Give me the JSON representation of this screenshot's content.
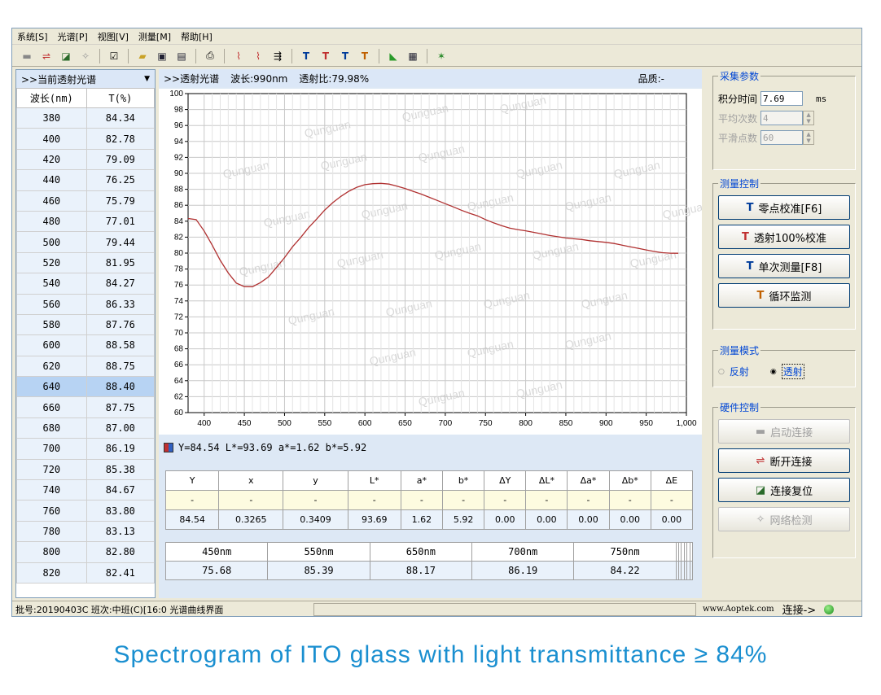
{
  "menu": [
    "系统[S]",
    "光谱[P]",
    "视图[V]",
    "测量[M]",
    "帮助[H]"
  ],
  "left_panel": {
    "header": ">>当前透射光谱",
    "col_wl": "波长(nm)",
    "col_t": "T(%)",
    "rows": [
      [
        "380",
        "84.34"
      ],
      [
        "400",
        "82.78"
      ],
      [
        "420",
        "79.09"
      ],
      [
        "440",
        "76.25"
      ],
      [
        "460",
        "75.79"
      ],
      [
        "480",
        "77.01"
      ],
      [
        "500",
        "79.44"
      ],
      [
        "520",
        "81.95"
      ],
      [
        "540",
        "84.27"
      ],
      [
        "560",
        "86.33"
      ],
      [
        "580",
        "87.76"
      ],
      [
        "600",
        "88.58"
      ],
      [
        "620",
        "88.75"
      ],
      [
        "640",
        "88.40"
      ],
      [
        "660",
        "87.75"
      ],
      [
        "680",
        "87.00"
      ],
      [
        "700",
        "86.19"
      ],
      [
        "720",
        "85.38"
      ],
      [
        "740",
        "84.67"
      ],
      [
        "760",
        "83.80"
      ],
      [
        "780",
        "83.13"
      ],
      [
        "800",
        "82.80"
      ],
      [
        "820",
        "82.41"
      ]
    ],
    "selected_index": 13
  },
  "chart_header": {
    "title": ">>透射光谱",
    "wavelength": "波长:990nm",
    "ratio": "透射比:79.98%",
    "quality": "品质:-"
  },
  "watermark": "Qunguan",
  "chart_data": {
    "type": "line",
    "x": [
      380,
      390,
      400,
      410,
      420,
      430,
      440,
      450,
      460,
      470,
      480,
      490,
      500,
      510,
      520,
      530,
      540,
      550,
      560,
      570,
      580,
      590,
      600,
      610,
      620,
      630,
      640,
      650,
      660,
      670,
      680,
      690,
      700,
      710,
      720,
      730,
      740,
      750,
      760,
      770,
      780,
      790,
      800,
      810,
      820,
      830,
      840,
      850,
      860,
      870,
      880,
      890,
      900,
      910,
      920,
      930,
      940,
      950,
      960,
      970,
      980,
      990
    ],
    "y": [
      84.34,
      84.2,
      82.78,
      81.0,
      79.09,
      77.5,
      76.25,
      75.8,
      75.79,
      76.3,
      77.01,
      78.2,
      79.44,
      80.8,
      81.95,
      83.2,
      84.27,
      85.4,
      86.33,
      87.1,
      87.76,
      88.25,
      88.58,
      88.7,
      88.75,
      88.65,
      88.4,
      88.1,
      87.75,
      87.4,
      87.0,
      86.6,
      86.19,
      85.8,
      85.38,
      85.0,
      84.67,
      84.2,
      83.8,
      83.45,
      83.13,
      82.95,
      82.8,
      82.6,
      82.41,
      82.2,
      82.05,
      81.9,
      81.8,
      81.7,
      81.55,
      81.45,
      81.35,
      81.2,
      81.0,
      80.8,
      80.6,
      80.4,
      80.2,
      80.05,
      79.99,
      79.98
    ],
    "xlim": [
      380,
      1000
    ],
    "ylim": [
      60,
      100
    ],
    "x_ticks": [
      400,
      450,
      500,
      550,
      600,
      650,
      700,
      750,
      800,
      850,
      900,
      950,
      1000
    ],
    "x_tick_labels": [
      "400",
      "450",
      "500",
      "550",
      "600",
      "650",
      "700",
      "750",
      "800",
      "850",
      "900",
      "950",
      "1,000"
    ],
    "y_ticks": [
      60,
      62,
      64,
      66,
      68,
      70,
      72,
      74,
      76,
      78,
      80,
      82,
      84,
      86,
      88,
      90,
      92,
      94,
      96,
      98,
      100
    ],
    "grid": true,
    "line_color": "#b03030"
  },
  "readout": "Y=84.54 L*=93.69 a*=1.62 b*=5.92",
  "color_table": {
    "headers": [
      "Y",
      "x",
      "y",
      "L*",
      "a*",
      "b*",
      "ΔY",
      "ΔL*",
      "Δa*",
      "Δb*",
      "ΔE"
    ],
    "ref": [
      "-",
      "-",
      "-",
      "-",
      "-",
      "-",
      "-",
      "-",
      "-",
      "-",
      "-"
    ],
    "values": [
      "84.54",
      "0.3265",
      "0.3409",
      "93.69",
      "1.62",
      "5.92",
      "0.00",
      "0.00",
      "0.00",
      "0.00",
      "0.00"
    ]
  },
  "nm_table": {
    "headers": [
      "450nm",
      "550nm",
      "650nm",
      "700nm",
      "750nm",
      "",
      "",
      "",
      "",
      "",
      ""
    ],
    "values": [
      "75.68",
      "85.39",
      "88.17",
      "86.19",
      "84.22",
      "",
      "",
      "",
      "",
      "",
      ""
    ]
  },
  "acq": {
    "title": "采集参数",
    "int_label": "积分时间",
    "int_value": "7.69",
    "int_unit": "ms",
    "avg_label": "平均次数",
    "avg_value": "4",
    "smooth_label": "平滑点数",
    "smooth_value": "60"
  },
  "meas_ctrl": {
    "title": "测量控制",
    "btn_zero": "零点校准[F6]",
    "btn_100": "透射100%校准",
    "btn_single": "单次测量[F8]",
    "btn_loop": "循环监测"
  },
  "meas_mode": {
    "title": "测量模式",
    "reflect": "反射",
    "transmit": "透射"
  },
  "hw_ctrl": {
    "title": "硬件控制",
    "btn_start": "启动连接",
    "btn_disconnect": "断开连接",
    "btn_reset": "连接复位",
    "btn_net": "网络检测"
  },
  "status": {
    "left": "批号:20190403C  班次:中班(C)[16:0 光谱曲线界面",
    "site": "www.Aoptek.com",
    "conn": "连接->"
  },
  "caption": "Spectrogram of ITO glass with light transmittance ≥ 84%"
}
